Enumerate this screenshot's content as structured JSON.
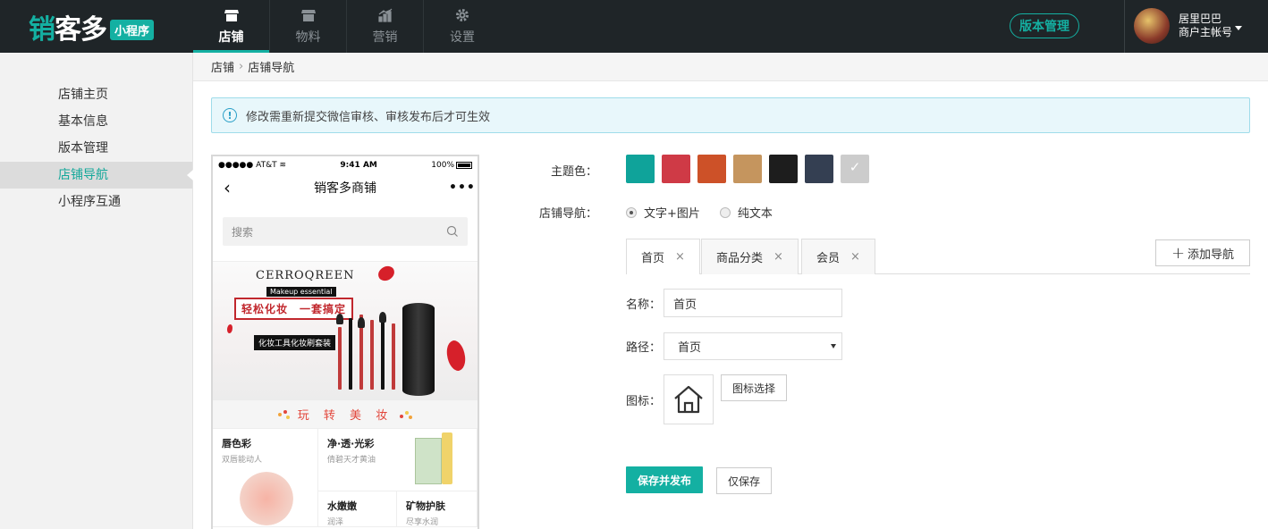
{
  "header": {
    "logo_text": "销客多",
    "logo_badge": "小程序",
    "nav": [
      {
        "label": "店铺",
        "icon": "store-icon",
        "active": true
      },
      {
        "label": "物料",
        "icon": "box-icon",
        "active": false
      },
      {
        "label": "营销",
        "icon": "chart-icon",
        "active": false
      },
      {
        "label": "设置",
        "icon": "gear-icon",
        "active": false
      }
    ],
    "version_button": "版本管理",
    "user_name": "居里巴巴",
    "user_role": "商户主帐号"
  },
  "sidebar": {
    "items": [
      {
        "label": "店铺主页"
      },
      {
        "label": "基本信息"
      },
      {
        "label": "版本管理"
      },
      {
        "label": "店铺导航"
      },
      {
        "label": "小程序互通"
      }
    ],
    "active_index": 3
  },
  "breadcrumb": {
    "root": "店铺",
    "current": "店铺导航"
  },
  "notice": {
    "icon": "!",
    "text": "修改需重新提交微信审核、审核发布后才可生效"
  },
  "preview": {
    "status_signal": "●●●●● AT&T",
    "status_time": "9:41 AM",
    "status_battery": "100%",
    "title": "销客多商铺",
    "more": "•••",
    "search_placeholder": "搜索",
    "banner_brand": "CERROQREEN",
    "banner_tag1": "Makeup essential",
    "banner_slogan": "轻松化妆　一套搞定",
    "banner_tag2": "化妆工具化妆刷套装",
    "section_title": "玩 转 美 妆",
    "products": [
      {
        "name": "唇色彩",
        "sub": "双唇能动人"
      },
      {
        "name": "净·透·光彩",
        "sub": "倩碧天才黄油"
      },
      {
        "name": "水嫩嫩",
        "sub": "润泽"
      },
      {
        "name": "矿物护肤",
        "sub": "尽享水润"
      }
    ]
  },
  "form": {
    "theme_label": "主题色：",
    "theme_colors": [
      "#0fa39a",
      "#cf3a46",
      "#cd5128",
      "#c5955e",
      "#1d1d1d",
      "#343f52",
      "#cccccc"
    ],
    "selected_color_index": 6,
    "nav_label": "店铺导航：",
    "nav_options": [
      "文字+图片",
      "纯文本"
    ],
    "nav_selected": 0,
    "tabs": [
      {
        "label": "首页",
        "close": "×"
      },
      {
        "label": "商品分类",
        "close": "×"
      },
      {
        "label": "会员",
        "close": "×"
      }
    ],
    "add_nav": "添加导航",
    "name_label": "名称：",
    "name_value": "首页",
    "path_label": "路径：",
    "path_value": "首页",
    "icon_label": "图标：",
    "icon_name": "home-icon",
    "icon_select": "图标选择",
    "save_publish": "保存并发布",
    "save_only": "仅保存"
  }
}
